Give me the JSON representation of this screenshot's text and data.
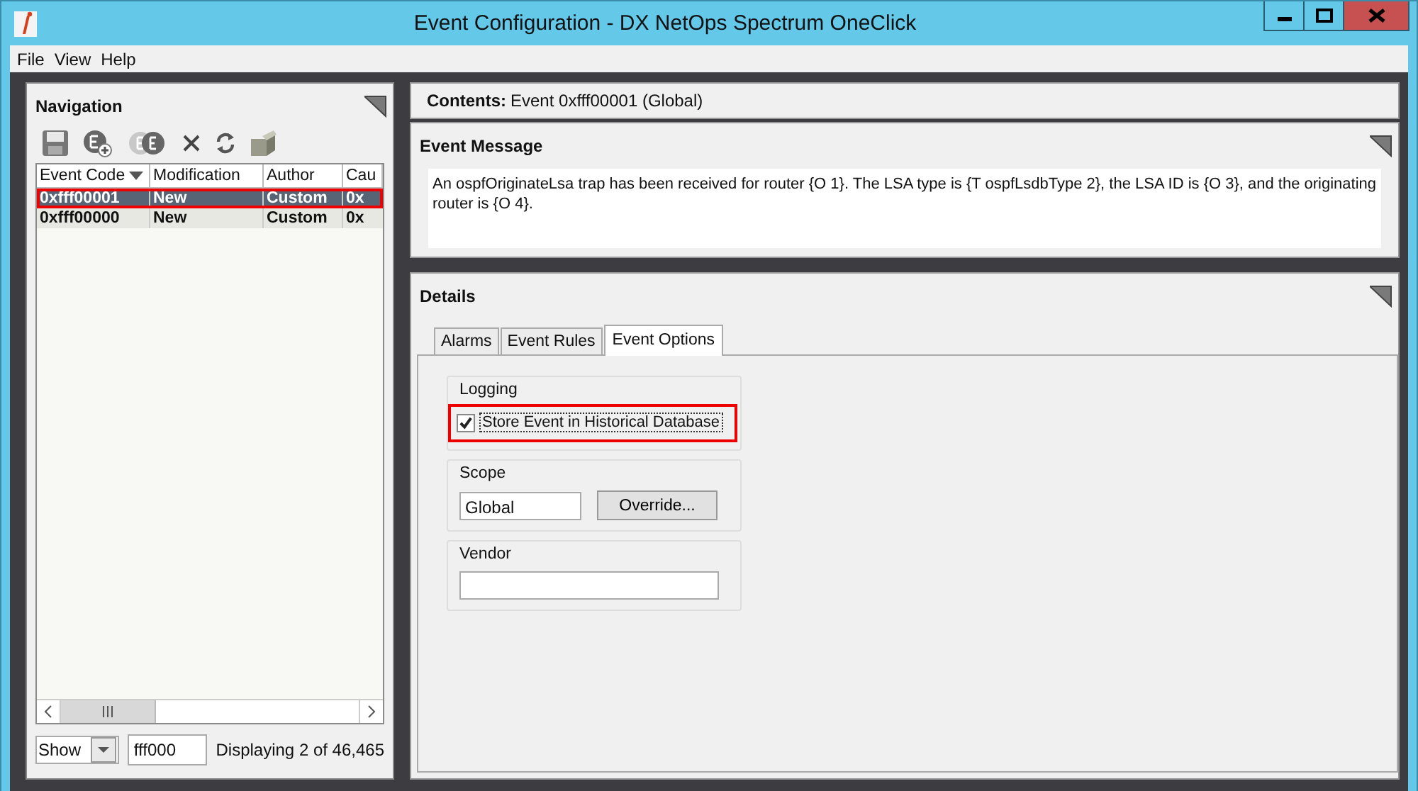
{
  "window": {
    "title": "Event Configuration - DX NetOps Spectrum OneClick"
  },
  "menu": [
    "File",
    "View",
    "Help"
  ],
  "navigation": {
    "title": "Navigation",
    "table": {
      "columns": [
        {
          "label": "Event Code",
          "sorted": true
        },
        {
          "label": "Modification"
        },
        {
          "label": "Author"
        },
        {
          "label": "Cau"
        }
      ],
      "rows": [
        {
          "cells": [
            "0xfff00001",
            "New",
            "Custom",
            "0x"
          ],
          "selected": true,
          "highlighted": true
        },
        {
          "cells": [
            "0xfff00000",
            "New",
            "Custom",
            "0x"
          ],
          "selected": false,
          "highlighted": false
        }
      ]
    },
    "filter": {
      "mode": "Show",
      "value": "fff000"
    },
    "status": "Displaying 2 of 46,465"
  },
  "contents": {
    "label": "Contents:",
    "value": "Event 0xfff00001  (Global)"
  },
  "event_message": {
    "title": "Event Message",
    "text": "An ospfOriginateLsa trap has been received for router {O 1}.  The LSA type is {T ospfLsdbType 2}, the LSA ID is {O 3}, and the originating router is {O 4}."
  },
  "details": {
    "title": "Details",
    "tabs": [
      {
        "label": "Alarms",
        "selected": false
      },
      {
        "label": "Event Rules",
        "selected": false
      },
      {
        "label": "Event Options",
        "selected": true
      }
    ],
    "logging": {
      "title": "Logging",
      "checkbox": {
        "label": "Store Event in Historical Database",
        "checked": true,
        "highlighted": true
      }
    },
    "scope": {
      "title": "Scope",
      "value": "Global",
      "button": "Override..."
    },
    "vendor": {
      "title": "Vendor"
    }
  }
}
